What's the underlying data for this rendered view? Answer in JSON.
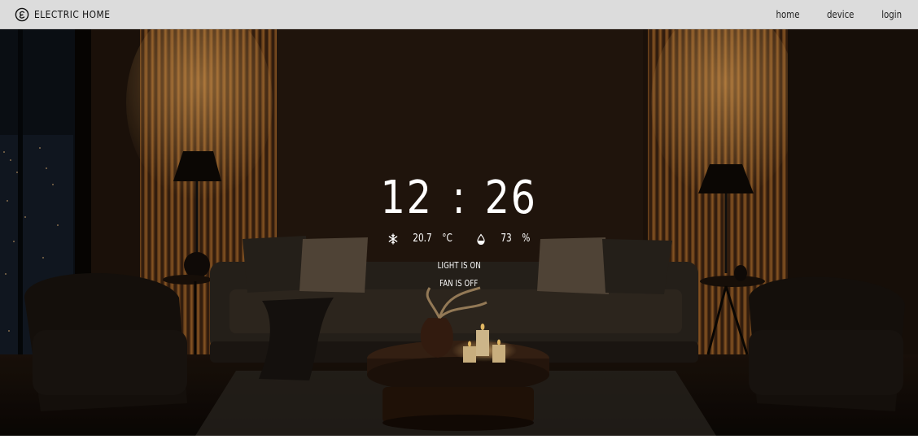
{
  "brand": {
    "name": "ELECTRIC HOME",
    "icon": "logo-e-icon"
  },
  "nav": {
    "items": [
      {
        "label": "home"
      },
      {
        "label": "device"
      },
      {
        "label": "login"
      }
    ]
  },
  "dashboard": {
    "clock": {
      "hours": "12",
      "separator": ":",
      "minutes": "26"
    },
    "temperature": {
      "icon": "snowflake-icon",
      "value": "20.7",
      "unit": "°C"
    },
    "humidity": {
      "icon": "water-drop-icon",
      "value": "73",
      "unit": "%"
    },
    "light_status": "LIGHT IS ON",
    "fan_status": "FAN IS OFF"
  },
  "colors": {
    "navbar_bg": "#dcdcdc",
    "overlay_text": "#ffffff",
    "warm_light": "#d08a3a"
  }
}
